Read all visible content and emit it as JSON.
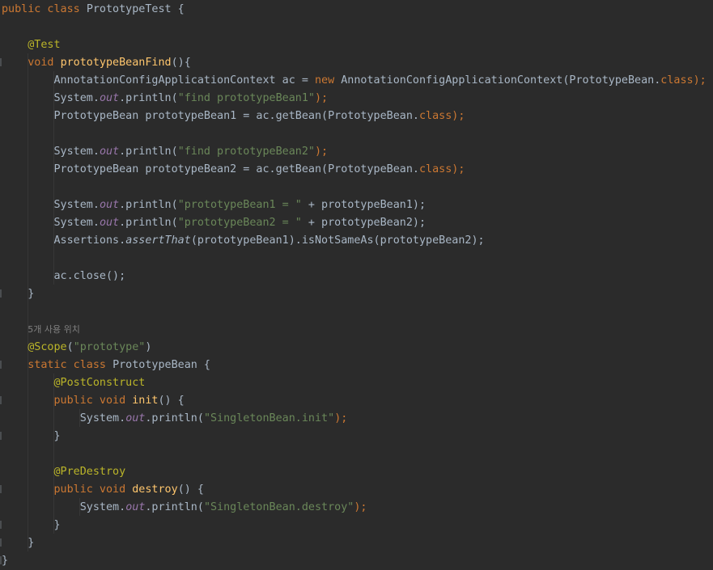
{
  "code": {
    "L1_kw": "public class ",
    "L1_name": "PrototypeTest {",
    "L3_ann": "@Test",
    "L4_kw": "void ",
    "L4_fn": "prototypeBeanFind",
    "L4_rest": "(){",
    "L5_a": "AnnotationConfigApplicationContext ac = ",
    "L5_new": "new ",
    "L5_b": "AnnotationConfigApplicationContext(PrototypeBean.",
    "L5_cls": "class",
    "L5_c": ");",
    "L6_a": "System.",
    "L6_out": "out",
    "L6_b": ".println(",
    "L6_str": "\"find prototypeBean1\"",
    "L6_c": ");",
    "L7_a": "PrototypeBean prototypeBean1 = ac.getBean(PrototypeBean.",
    "L7_cls": "class",
    "L7_c": ");",
    "L9_a": "System.",
    "L9_out": "out",
    "L9_b": ".println(",
    "L9_str": "\"find prototypeBean2\"",
    "L9_c": ");",
    "L10_a": "PrototypeBean prototypeBean2 = ac.getBean(PrototypeBean.",
    "L10_cls": "class",
    "L10_c": ");",
    "L12_a": "System.",
    "L12_out": "out",
    "L12_b": ".println(",
    "L12_str": "\"prototypeBean1 = \"",
    "L12_c": " + prototypeBean1);",
    "L13_a": "System.",
    "L13_out": "out",
    "L13_b": ".println(",
    "L13_str": "\"prototypeBean2 = \"",
    "L13_c": " + prototypeBean2);",
    "L14_a": "Assertions.",
    "L14_m": "assertThat",
    "L14_b": "(prototypeBean1).isNotSameAs(prototypeBean2);",
    "L16_a": "ac.close();",
    "L17": "}",
    "hint": "5개 사용 위치",
    "L19_ann": "@Scope",
    "L19_a": "(",
    "L19_str": "\"prototype\"",
    "L19_b": ")",
    "L20_kw": "static class ",
    "L20_b": "PrototypeBean {",
    "L21_ann": "@PostConstruct",
    "L22_kw": "public void ",
    "L22_fn": "init",
    "L22_b": "() {",
    "L23_a": "System.",
    "L23_out": "out",
    "L23_b": ".println(",
    "L23_str": "\"SingletonBean.init\"",
    "L23_c": ");",
    "L24": "}",
    "L26_ann": "@PreDestroy",
    "L27_kw": "public void ",
    "L27_fn": "destroy",
    "L27_b": "() {",
    "L28_a": "System.",
    "L28_out": "out",
    "L28_b": ".println(",
    "L28_str": "\"SingletonBean.destroy\"",
    "L28_c": ");",
    "L29": "}",
    "L30": "}",
    "L31": "}"
  },
  "colors": {
    "background": "#2b2b2b",
    "default_text": "#a9b7c6",
    "keyword": "#cc7832",
    "annotation": "#bbb529",
    "string": "#6a8759",
    "method_decl": "#ffc66d",
    "static_field": "#9876aa",
    "hint": "#808080"
  }
}
